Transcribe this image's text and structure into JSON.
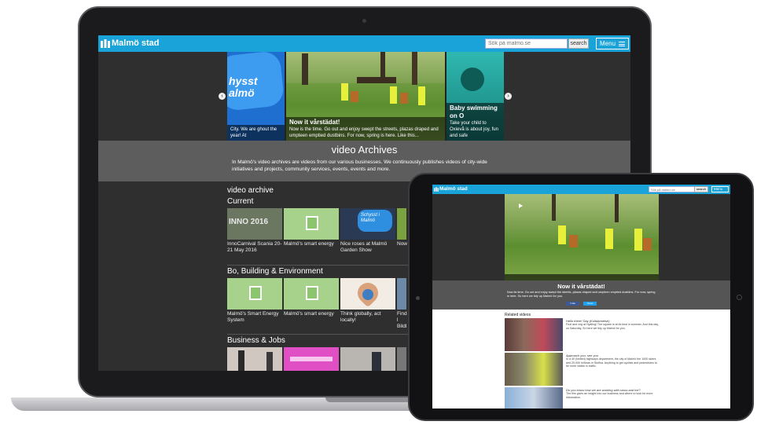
{
  "laptop": {
    "header": {
      "logo_text": "Malmö stad",
      "search_placeholder": "Sök på malmo.se",
      "search_button": "search",
      "menu_label": "Menu"
    },
    "carousel": {
      "slides": [
        {
          "title": "",
          "caption": "City. We are ghout the year! At",
          "sign_text": "hysst almö"
        },
        {
          "title": "Now it vårstädat!",
          "caption": "Now is the time. Go out and enjoy swept the streets, plazas draped and umpteen emptied dustbins. For now, spring is here. Like this..."
        },
        {
          "title": "Baby swimming on O",
          "caption": "Take your child to Oxievå is about joy, fun and safe"
        }
      ],
      "prev_arrow": "‹",
      "next_arrow": "›"
    },
    "archive": {
      "title": "video Archives",
      "text": "In Malmö's video archives are videos from our various businesses. We continuously publishes videos of city-wide initiatives and projects, community services, events, events and more."
    },
    "video_archive_label": "video archive",
    "sections": [
      {
        "title": "Current",
        "items": [
          {
            "caption": "InnoCarnival Scania 20-21 May 2016",
            "art": "INNO 2016"
          },
          {
            "caption": "Malmö's smart energy"
          },
          {
            "caption": "Nice roses at Malmö Garden Show",
            "art": "Schysst i Malmö"
          },
          {
            "caption": "Now"
          }
        ]
      },
      {
        "title": "Bo, Building & Environment",
        "items": [
          {
            "caption": "Malmö's Smart Energy System"
          },
          {
            "caption": "Malmö's smart energy"
          },
          {
            "caption": "Think globally, act locally!"
          },
          {
            "caption": "Find l Bildl"
          }
        ]
      },
      {
        "title": "Business & Jobs",
        "items": [
          {
            "caption": ""
          },
          {
            "caption": ""
          },
          {
            "caption": ""
          },
          {
            "caption": ""
          }
        ]
      }
    ]
  },
  "tablet": {
    "header": {
      "logo_text": "Malmö stad",
      "search_placeholder": "Sök på malmo.se",
      "search_button": "search",
      "menu_label": "Menu"
    },
    "video": {
      "title": "Now it vårstädat!",
      "description": "Now its time. Go out and enjoy swept the streets, plazas draped and umpteen emptied dustbins. For now, spring is here. So here we tidy up Malmö for you.",
      "share": [
        "f Like",
        "Tweet"
      ]
    },
    "related_label": "Related videos",
    "related": [
      {
        "title": "Hello there! Day (Kultdannelse)",
        "desc": "Fruit and veg at Hyallng! The square is at its best in summer. And this day, on Saturday, So here we tidy up Malmö for you."
      },
      {
        "title": "Approach you, see you",
        "desc": "In a 40 (limited) highways department, the city of Malmö the 1000 skiers and 20,000 in/flows in Sköfna. Anything to get cyclists and pedestrians to be more visible in traffic."
      },
      {
        "title": "Do you know how we are working with snow and ice?",
        "desc": "The film gives an insight into our business and where to look for more information."
      }
    ]
  },
  "colors": {
    "brand_blue": "#1aa3d9",
    "page_dark": "#2f2f2f",
    "band_gray": "#5d5d5d"
  }
}
